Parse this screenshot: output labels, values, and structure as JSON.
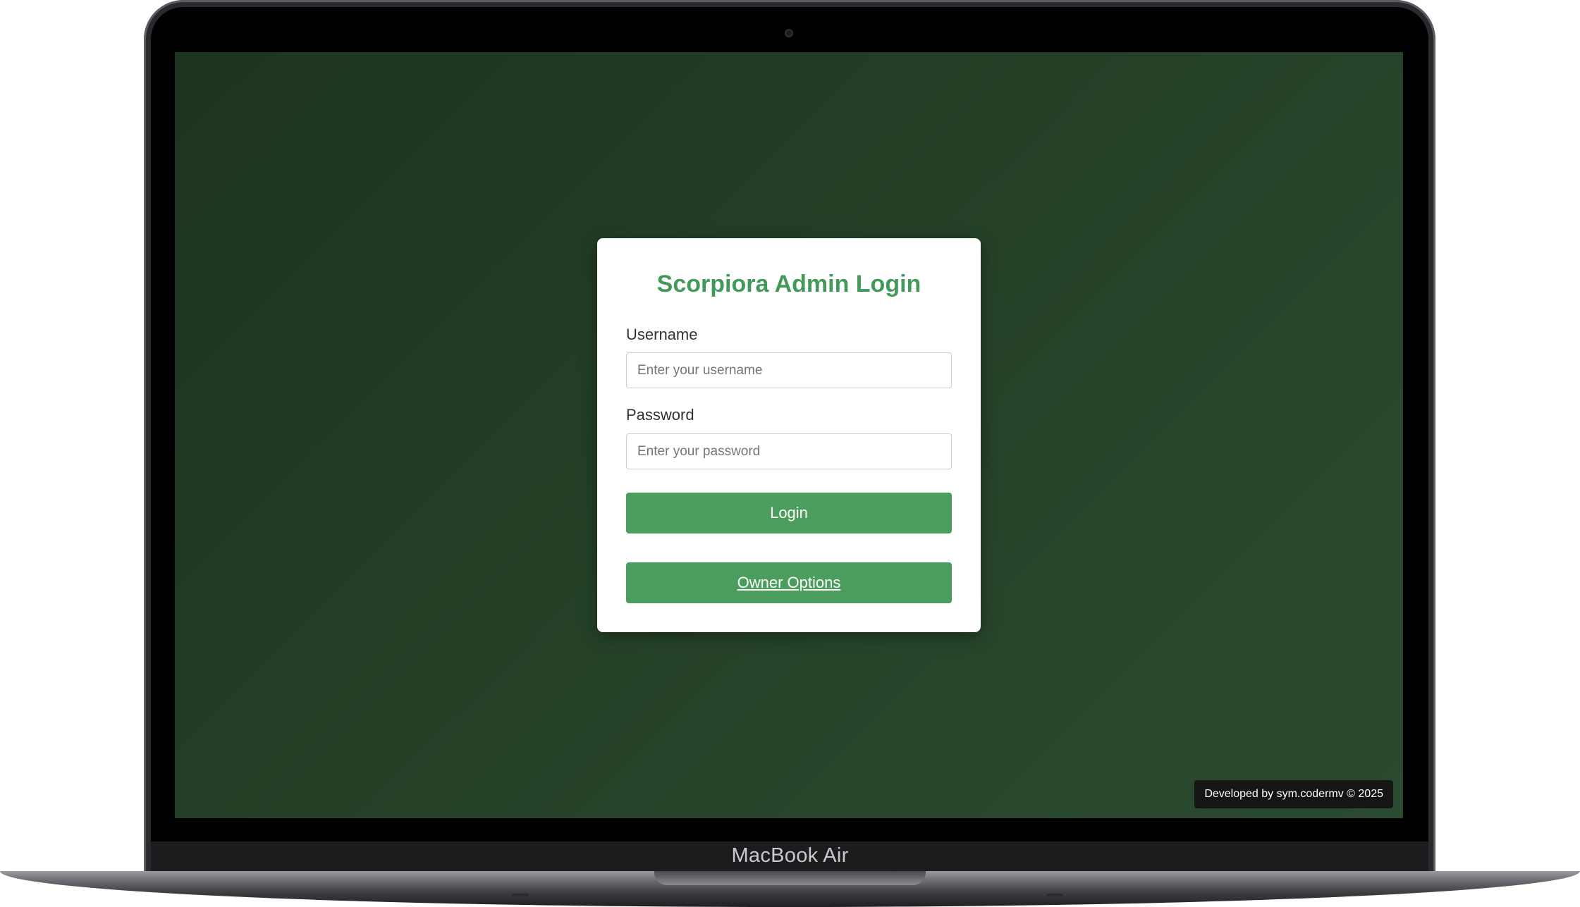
{
  "device": {
    "model_label": "MacBook Air"
  },
  "login": {
    "title": "Scorpiora Admin Login",
    "username_label": "Username",
    "username_placeholder": "Enter your username",
    "username_value": "",
    "password_label": "Password",
    "password_placeholder": "Enter your password",
    "password_value": "",
    "login_button": "Login",
    "owner_options_button": "Owner Options"
  },
  "footer": {
    "credit": "Developed by sym.codermv © 2025"
  },
  "colors": {
    "accent_green": "#4a9d5c",
    "title_green": "#43995a",
    "background_dark_green": "#234027",
    "card_background": "#ffffff",
    "footer_badge": "#151515"
  }
}
